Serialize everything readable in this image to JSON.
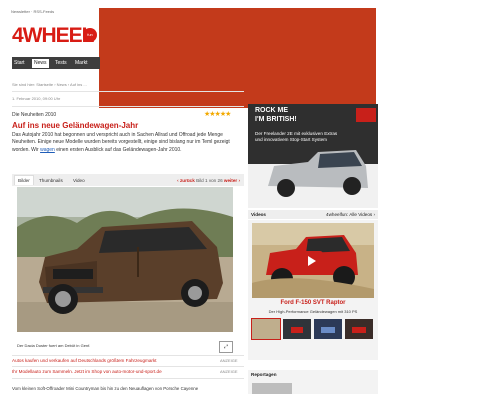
{
  "header": {
    "top_links": "Newsletter · RSS-Feeds",
    "logo_text": "4WHEEL",
    "logo_badge": "fun",
    "nav": [
      {
        "label": "Start"
      },
      {
        "label": "News"
      },
      {
        "label": "Tests"
      },
      {
        "label": "Markt"
      }
    ],
    "banner_color": "#c33a1b"
  },
  "breadcrumb": "Sie sind hier:  Startseite › News › Auf ins ...",
  "date_path": "1. Februar 2010, 09:00 Uhr",
  "article": {
    "kicker": "Die Neuheiten 2010",
    "rating": "★★★★★",
    "headline": "Auf ins neue Geländewagen-Jahr",
    "teaser_1": "Das Autojahr 2010 hat begonnen und verspricht auch in Sachen Allrad und Offroad jede Menge Neuheiten. Einige neue Modelle wurden bereits vorgestellt, einige sind bislang nur im Teml gezeigt worden. Wir",
    "teaser_link": "wagen",
    "teaser_2": "einen ersten Ausblick auf das Geländewagen-Jahr 2010.",
    "tabs": [
      {
        "label": "Bilder"
      },
      {
        "label": "Thumbnails"
      },
      {
        "label": "Video"
      }
    ],
    "pager_prev": "‹ zurück",
    "pager_count": "Bild 1 von 26",
    "pager_next": "weiter ›",
    "photo_caption": "Der Dacia Duster fuert am Debüt in Genf.",
    "zoom_icon": "⤢"
  },
  "ad_lines": [
    {
      "text": "Autos kaufen und verkaufen auf Deutschlands größtem Fahrzeugmarkt",
      "tag": "ANZEIGE"
    },
    {
      "text": "Ihr Modellauto zum Sammeln. Jetzt im Shop von auto-motor-und-sport.de",
      "tag": "ANZEIGE"
    }
  ],
  "bottom_text": "Vom kleinen Soft-Offroader Mini Countryman bis hin zu den Neuauflagen von Porsche Cayenne",
  "sidebar": {
    "ad_title_1": "ROCK ME",
    "ad_title_2": "I'M BRITISH!",
    "ad_sub": "Der Freelander 2E mit exklusiven Extras und innovativem Stop-Start System",
    "videos_label": "Videos",
    "videos_link": "4wheelfun: Alle Videos ›",
    "video_title": "Ford F-150 SVT Raptor",
    "video_sub": "Der High-Performance Geländewagen mit 310 PS",
    "panel2_label": "Reportagen"
  }
}
